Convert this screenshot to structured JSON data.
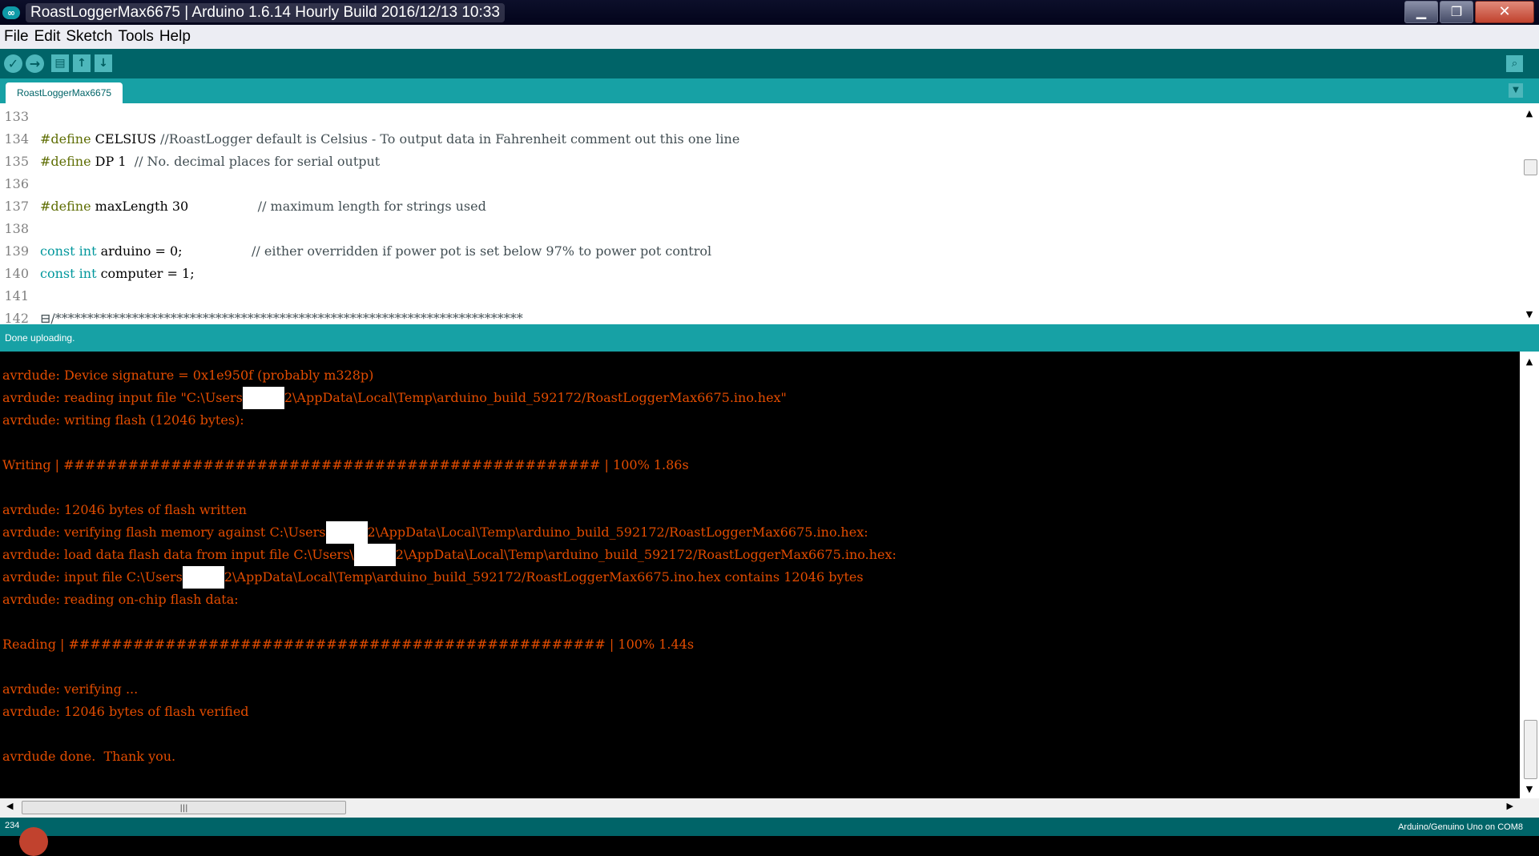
{
  "window": {
    "title": "RoastLoggerMax6675 | Arduino 1.6.14 Hourly Build 2016/12/13 10:33",
    "logo_glyph": "∞",
    "minimize_glyph": "▁",
    "restore_glyph": "❐",
    "close_glyph": "✕"
  },
  "menu": [
    "File",
    "Edit",
    "Sketch",
    "Tools",
    "Help"
  ],
  "toolbar": {
    "verify_glyph": "✓",
    "upload_glyph": "→",
    "new_glyph": "▤",
    "open_glyph": "↑",
    "save_glyph": "↓",
    "serial_glyph": "⌕"
  },
  "tab": {
    "label": "RoastLoggerMax6675",
    "menu_glyph": "▼"
  },
  "editor": {
    "lines": [
      {
        "num": "133",
        "segments": []
      },
      {
        "num": "134",
        "segments": [
          {
            "cls": "kw",
            "text": "#define"
          },
          {
            "cls": "",
            "text": " CELSIUS "
          },
          {
            "cls": "cm",
            "text": "//RoastLogger default is Celsius - To output data in Fahrenheit comment out this one line"
          }
        ]
      },
      {
        "num": "135",
        "segments": [
          {
            "cls": "kw",
            "text": "#define"
          },
          {
            "cls": "",
            "text": " DP 1  "
          },
          {
            "cls": "cm",
            "text": "// No. decimal places for serial output"
          }
        ]
      },
      {
        "num": "136",
        "segments": []
      },
      {
        "num": "137",
        "segments": [
          {
            "cls": "kw",
            "text": "#define"
          },
          {
            "cls": "",
            "text": " maxLength 30                 "
          },
          {
            "cls": "cm",
            "text": "// maximum length for strings used"
          }
        ]
      },
      {
        "num": "138",
        "segments": []
      },
      {
        "num": "139",
        "segments": [
          {
            "cls": "ty",
            "text": "const"
          },
          {
            "cls": "",
            "text": " "
          },
          {
            "cls": "ty",
            "text": "int"
          },
          {
            "cls": "",
            "text": " arduino = 0;                 "
          },
          {
            "cls": "cm",
            "text": "// either overridden if power pot is set below 97% to power pot control"
          }
        ]
      },
      {
        "num": "140",
        "segments": [
          {
            "cls": "ty",
            "text": "const"
          },
          {
            "cls": "",
            "text": " "
          },
          {
            "cls": "ty",
            "text": "int"
          },
          {
            "cls": "",
            "text": " computer = 1;"
          }
        ]
      },
      {
        "num": "141",
        "segments": []
      },
      {
        "num": "142",
        "segments": [
          {
            "cls": "cm",
            "text": "⊟/*************************************************************************"
          }
        ]
      }
    ]
  },
  "status": {
    "message": "Done uploading."
  },
  "console": {
    "lines": [
      [
        "avrdude: Device signature = 0x1e950f (probably m328p)"
      ],
      [
        "avrdude: reading input file \"C:\\Users",
        null,
        "2\\AppData\\Local\\Temp\\arduino_build_592172/RoastLoggerMax6675.ino.hex\""
      ],
      [
        "avrdude: writing flash (12046 bytes):"
      ],
      [
        ""
      ],
      [
        "Writing | ################################################## | 100% 1.86s"
      ],
      [
        ""
      ],
      [
        "avrdude: 12046 bytes of flash written"
      ],
      [
        "avrdude: verifying flash memory against C:\\Users",
        null,
        "2\\AppData\\Local\\Temp\\arduino_build_592172/RoastLoggerMax6675.ino.hex:"
      ],
      [
        "avrdude: load data flash data from input file C:\\Users\\",
        null,
        "2\\AppData\\Local\\Temp\\arduino_build_592172/RoastLoggerMax6675.ino.hex:"
      ],
      [
        "avrdude: input file C:\\Users",
        null,
        "2\\AppData\\Local\\Temp\\arduino_build_592172/RoastLoggerMax6675.ino.hex contains 12046 bytes"
      ],
      [
        "avrdude: reading on-chip flash data:"
      ],
      [
        ""
      ],
      [
        "Reading | ################################################## | 100% 1.44s"
      ],
      [
        ""
      ],
      [
        "avrdude: verifying ..."
      ],
      [
        "avrdude: 12046 bytes of flash verified"
      ],
      [
        ""
      ],
      [
        "avrdude done.  Thank you."
      ]
    ]
  },
  "scroll": {
    "up_glyph": "▲",
    "down_glyph": "▼",
    "left_glyph": "◀",
    "right_glyph": "▶",
    "grip_glyph": "|||"
  },
  "footer": {
    "line_number": "234",
    "board": "Arduino/Genuino Uno on COM8"
  },
  "colors": {
    "teal_dark": "#006468",
    "teal_light": "#17a1a5",
    "console_text": "#e34c00",
    "keyword": "#5e6d03",
    "type": "#00979c",
    "comment": "#434f54"
  }
}
